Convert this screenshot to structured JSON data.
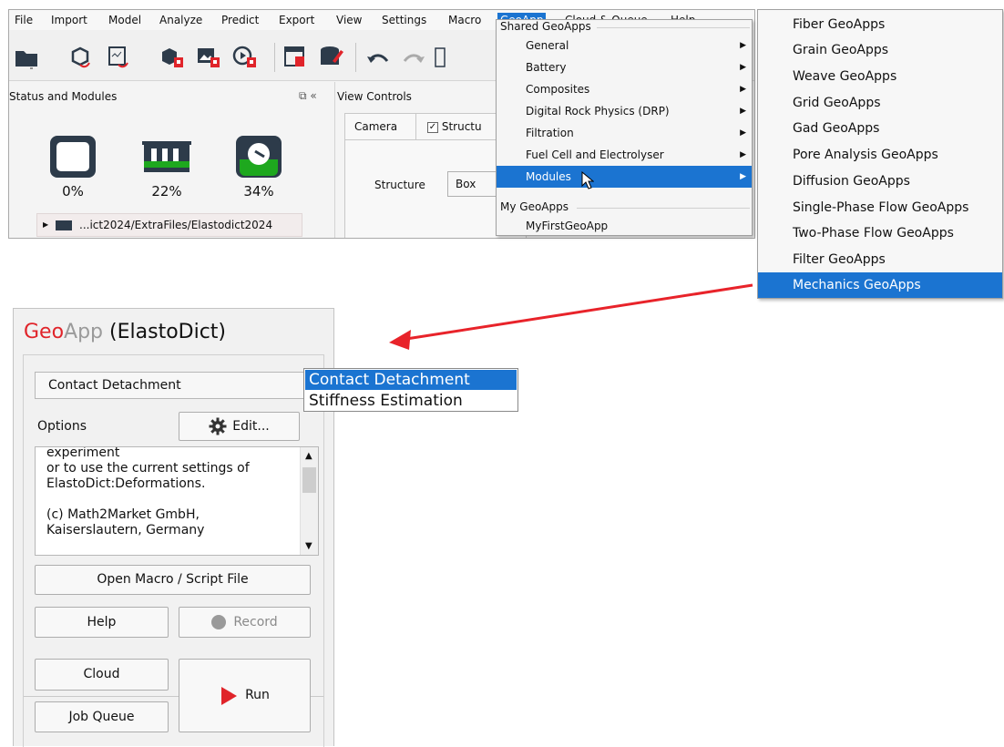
{
  "menubar": {
    "items": [
      "File",
      "Import",
      "Model",
      "Analyze",
      "Predict",
      "Export",
      "View",
      "Settings",
      "Macro",
      "GeoApp",
      "Cloud & Queue",
      "Help"
    ],
    "active": "GeoApp"
  },
  "status_panel": {
    "title": "Status and Modules",
    "controls": "⧉ «",
    "meters": [
      "0%",
      "22%",
      "34%"
    ],
    "file_path": "...ict2024/ExtraFiles/Elastodict2024"
  },
  "view_panel": {
    "title": "View Controls",
    "tabs": [
      "Camera",
      "Structu"
    ],
    "structure_label": "Structure",
    "structure_value": "Box"
  },
  "geoapp_menu": {
    "section_shared": "Shared GeoApps",
    "items": [
      "General",
      "Battery",
      "Composites",
      "Digital Rock Physics (DRP)",
      "Filtration",
      "Fuel Cell and Electrolyser",
      "Modules"
    ],
    "selected": "Modules",
    "section_mine": "My GeoApps",
    "my_items": [
      "MyFirstGeoApp"
    ]
  },
  "modules_submenu": {
    "items": [
      "Fiber GeoApps",
      "Grain GeoApps",
      "Weave GeoApps",
      "Grid GeoApps",
      "Gad GeoApps",
      "Pore Analysis GeoApps",
      "Diffusion GeoApps",
      "Single-Phase Flow GeoApps",
      "Two-Phase Flow GeoApps",
      "Filter GeoApps",
      "Mechanics GeoApps"
    ],
    "selected": "Mechanics GeoApps"
  },
  "geoapp_panel": {
    "title_geo": "Geo",
    "title_app": "App",
    "title_name": " (ElastoDict)",
    "combo_value": "Contact Detachment",
    "options_label": "Options",
    "edit_label": "Edit...",
    "description": "experiment\nor to use the current settings of\nElastoDict:Deformations.\n\n(c) Math2Market GmbH,\nKaiserslautern, Germany",
    "open_macro_label": "Open Macro / Script File",
    "help_label": "Help",
    "record_label": "Record",
    "cloud_label": "Cloud",
    "job_queue_label": "Job Queue",
    "run_label": "Run"
  },
  "combo_popup": {
    "items": [
      "Contact Detachment",
      "Stiffness Estimation"
    ],
    "selected": "Contact Detachment"
  },
  "colors": {
    "accent_blue": "#1b74d1",
    "geo_red": "#e0242a",
    "arrow_red": "#e8232a",
    "meter_green": "#1ea81e"
  }
}
